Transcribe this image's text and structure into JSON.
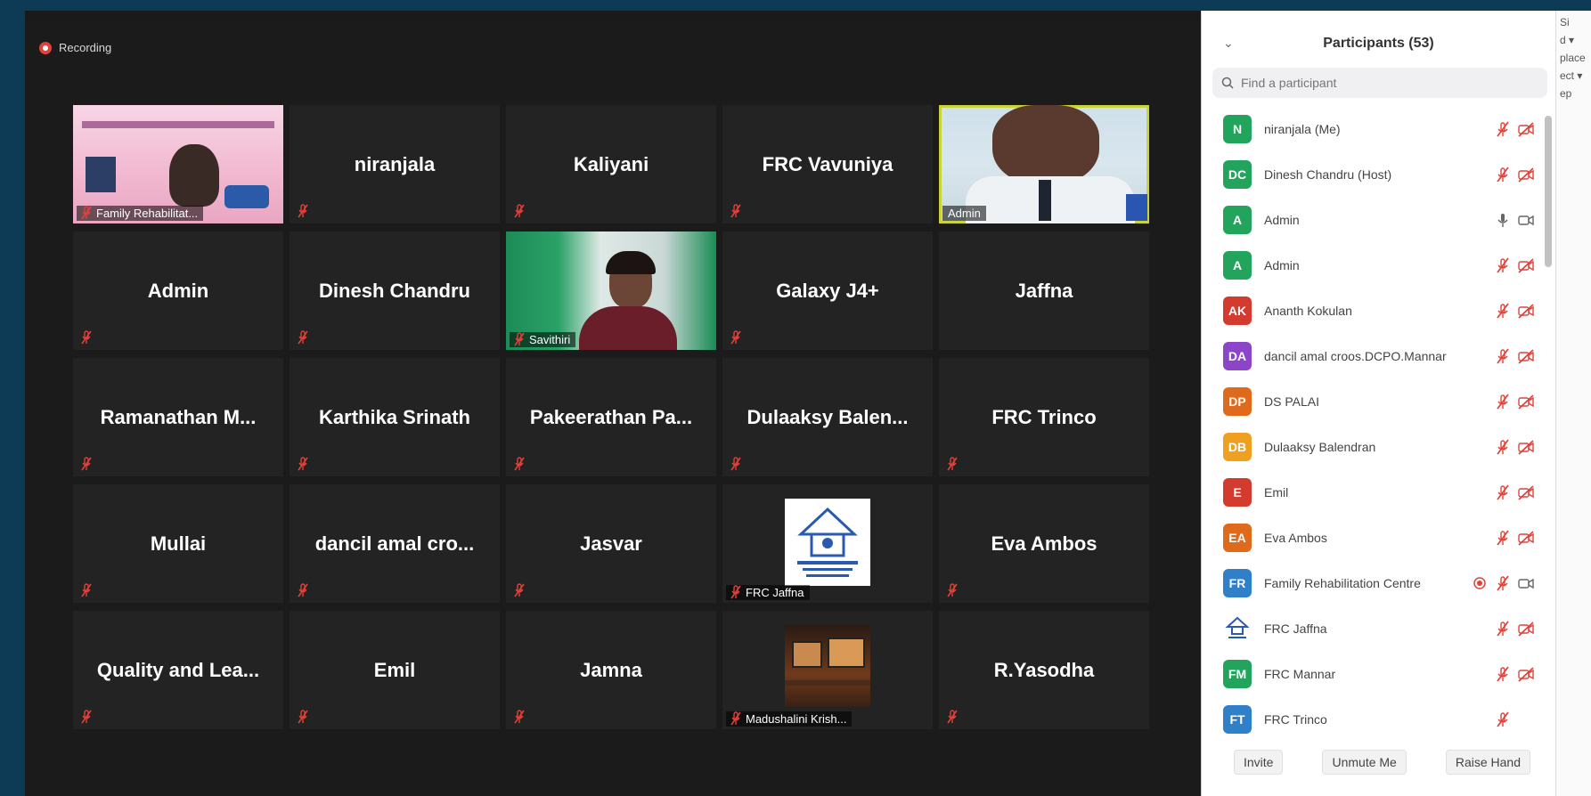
{
  "recording": {
    "label": "Recording"
  },
  "tiles": [
    {
      "kind": "video",
      "style": "vid-slide",
      "caption": "Family Rehabilitat...",
      "active": false
    },
    {
      "kind": "name",
      "name": "niranjala"
    },
    {
      "kind": "name",
      "name": "Kaliyani"
    },
    {
      "kind": "name",
      "name": "FRC Vavuniya"
    },
    {
      "kind": "video",
      "style": "vid-admin",
      "caption": "Admin",
      "active": true,
      "nomute": true
    },
    {
      "kind": "name",
      "name": "Admin"
    },
    {
      "kind": "name",
      "name": "Dinesh Chandru"
    },
    {
      "kind": "video",
      "style": "vid-sav",
      "caption": "Savithiri",
      "active": false
    },
    {
      "kind": "name",
      "name": "Galaxy J4+"
    },
    {
      "kind": "name",
      "name": "Jaffna",
      "nomute": true
    },
    {
      "kind": "name",
      "name": "Ramanathan  M..."
    },
    {
      "kind": "name",
      "name": "Karthika Srinath"
    },
    {
      "kind": "name",
      "name": "Pakeerathan  Pa..."
    },
    {
      "kind": "name",
      "name": "Dulaaksy  Balen..."
    },
    {
      "kind": "name",
      "name": "FRC Trinco"
    },
    {
      "kind": "name",
      "name": "Mullai"
    },
    {
      "kind": "name",
      "name": "dancil  amal  cro..."
    },
    {
      "kind": "name",
      "name": "Jasvar"
    },
    {
      "kind": "video",
      "style": "vid-logo",
      "caption": "FRC Jaffna",
      "active": false
    },
    {
      "kind": "name",
      "name": "Eva Ambos"
    },
    {
      "kind": "name",
      "name": "Quality  and  Lea..."
    },
    {
      "kind": "name",
      "name": "Emil"
    },
    {
      "kind": "name",
      "name": "Jamna"
    },
    {
      "kind": "video",
      "style": "vid-desk",
      "caption": "Madushalini Krish...",
      "active": false
    },
    {
      "kind": "name",
      "name": "R.Yasodha"
    }
  ],
  "panel": {
    "title": "Participants (53)",
    "search_placeholder": "Find a participant",
    "participants": [
      {
        "initials": "N",
        "name": "niranjala (Me)",
        "color": "#22a45d",
        "audio": "muted",
        "video": "off"
      },
      {
        "initials": "DC",
        "name": "Dinesh Chandru (Host)",
        "color": "#22a45d",
        "audio": "muted",
        "video": "off"
      },
      {
        "initials": "A",
        "name": "Admin",
        "color": "#22a45d",
        "audio": "on",
        "video": "on"
      },
      {
        "initials": "A",
        "name": "Admin",
        "color": "#22a45d",
        "audio": "muted",
        "video": "off"
      },
      {
        "initials": "AK",
        "name": "Ananth Kokulan",
        "color": "#d23b2e",
        "audio": "muted",
        "video": "off"
      },
      {
        "initials": "DA",
        "name": "dancil amal croos.DCPO.Mannar",
        "color": "#8c44c9",
        "audio": "muted",
        "video": "off"
      },
      {
        "initials": "DP",
        "name": "DS PALAI",
        "color": "#e06a1c",
        "audio": "muted",
        "video": "off"
      },
      {
        "initials": "DB",
        "name": "Dulaaksy Balendran",
        "color": "#f0a020",
        "audio": "muted",
        "video": "off"
      },
      {
        "initials": "E",
        "name": "Emil",
        "color": "#d23b2e",
        "audio": "muted",
        "video": "off"
      },
      {
        "initials": "EA",
        "name": "Eva Ambos",
        "color": "#e06a1c",
        "audio": "muted",
        "video": "off"
      },
      {
        "initials": "FR",
        "name": "Family Rehabilitation Centre",
        "color": "#2f7fc9",
        "audio": "muted",
        "video": "on",
        "recording": true
      },
      {
        "initials": "",
        "name": "FRC Jaffna",
        "color": "logo",
        "audio": "muted",
        "video": "off"
      },
      {
        "initials": "FM",
        "name": "FRC Mannar",
        "color": "#22a45d",
        "audio": "muted",
        "video": "off"
      },
      {
        "initials": "FT",
        "name": "FRC Trinco",
        "color": "#2f7fc9",
        "audio": "muted",
        "video": "none"
      }
    ],
    "buttons": {
      "invite": "Invite",
      "unmute": "Unmute Me",
      "raise": "Raise Hand"
    }
  },
  "edge": {
    "lines": [
      "Si",
      "d ▾",
      "place",
      "ect ▾",
      "ep"
    ]
  }
}
